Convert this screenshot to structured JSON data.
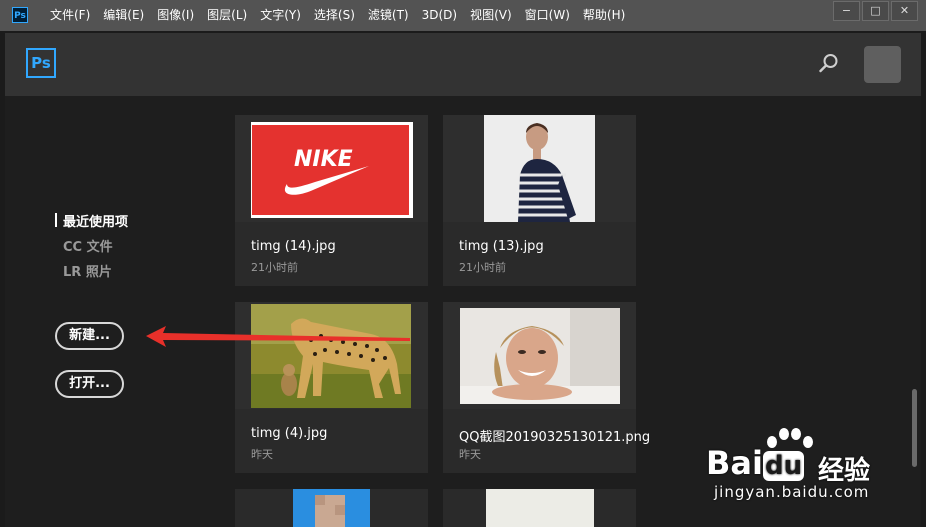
{
  "menubar": {
    "app_icon": "Ps",
    "items": [
      "文件(F)",
      "编辑(E)",
      "图像(I)",
      "图层(L)",
      "文字(Y)",
      "选择(S)",
      "滤镜(T)",
      "3D(D)",
      "视图(V)",
      "窗口(W)",
      "帮助(H)"
    ],
    "window_buttons": [
      "−",
      "□",
      "✕"
    ]
  },
  "header": {
    "logo": "Ps"
  },
  "nav": {
    "items": [
      "最近使用项",
      "CC 文件",
      "LR 照片"
    ],
    "new_label": "新建...",
    "open_label": "打开..."
  },
  "files": [
    {
      "name": "timg (14).jpg",
      "time": "21小时前",
      "thumb": "nike-red-logo"
    },
    {
      "name": "timg (13).jpg",
      "time": "21小时前",
      "thumb": "woman-striped-shirt"
    },
    {
      "name": "timg (4).jpg",
      "time": "昨天",
      "thumb": "cheetah-grass"
    },
    {
      "name": "QQ截图20190325130121.png",
      "time": "昨天",
      "thumb": "smiling-woman"
    }
  ],
  "watermark": {
    "brand": "Bai",
    "brand2": "du",
    "cn": "经验",
    "url": "jingyan.baidu.com"
  },
  "colors": {
    "accent": "#31a8ff",
    "arrow": "#e8302a",
    "menubar": "#535353",
    "nike_red": "#e4322f"
  }
}
